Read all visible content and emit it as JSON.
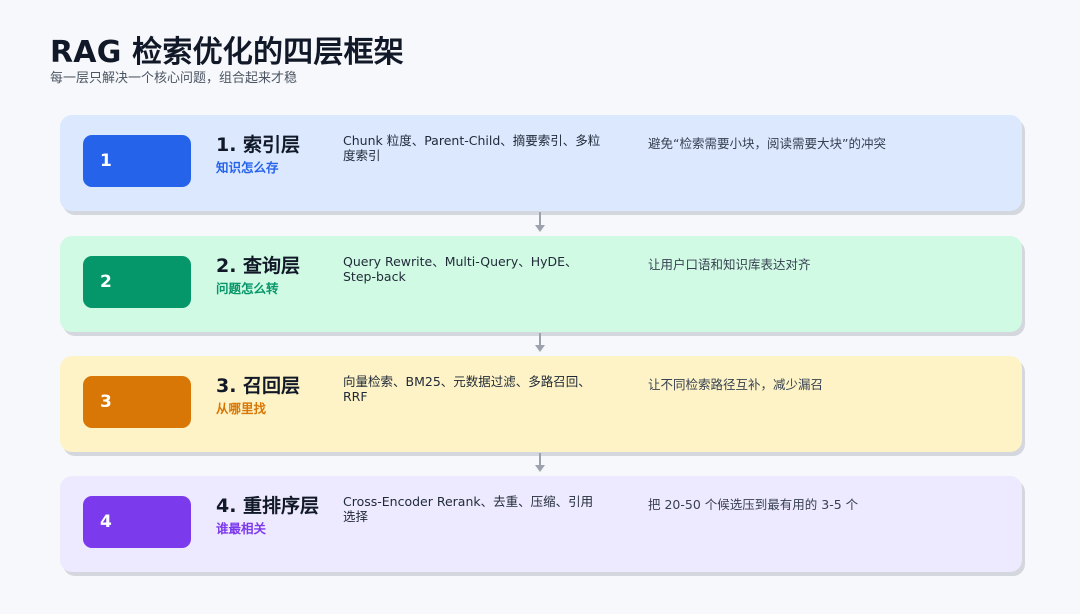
{
  "header": {
    "title": "RAG 检索优化的四层框架",
    "subtitle": "每一层只解决一个核心问题，组合起来才稳"
  },
  "layers": [
    {
      "number": "1",
      "name": "1. 索引层",
      "question": "知识怎么存",
      "methods": "Chunk 粒度、Parent-Child、摘要索引、多粒度索引",
      "goal": "避免“检索需要小块，阅读需要大块”的冲突",
      "accent": "#2563eb"
    },
    {
      "number": "2",
      "name": "2. 查询层",
      "question": "问题怎么转",
      "methods": "Query Rewrite、Multi-Query、HyDE、Step-back",
      "goal": "让用户口语和知识库表达对齐",
      "accent": "#059669"
    },
    {
      "number": "3",
      "name": "3. 召回层",
      "question": "从哪里找",
      "methods": "向量检索、BM25、元数据过滤、多路召回、RRF",
      "goal": "让不同检索路径互补，减少漏召",
      "accent": "#d97706"
    },
    {
      "number": "4",
      "name": "4. 重排序层",
      "question": "谁最相关",
      "methods": "Cross-Encoder Rerank、去重、压缩、引用选择",
      "goal": "把 20-50 个候选压到最有用的 3-5 个",
      "accent": "#7c3aed"
    }
  ]
}
